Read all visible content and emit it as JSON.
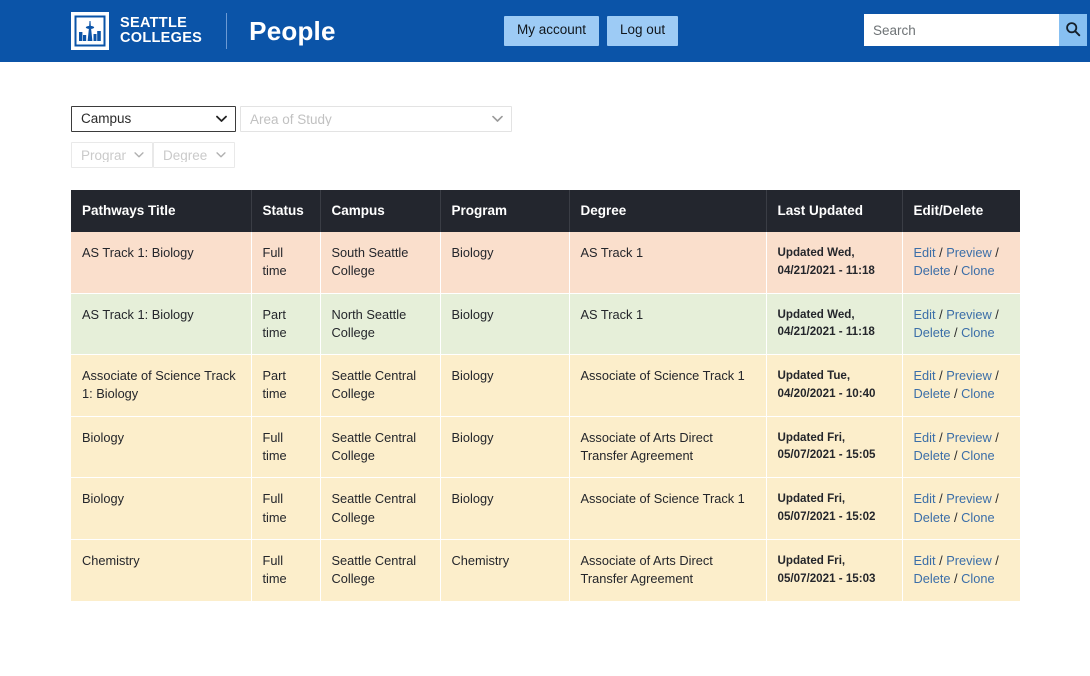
{
  "header": {
    "logo_icon": "seattle-colleges-skyline-logo",
    "logo_line1": "SEATTLE",
    "logo_line2": "COLLEGES",
    "app_title": "People",
    "my_account_label": "My account",
    "log_out_label": "Log out",
    "search_placeholder": "Search",
    "search_value": "",
    "search_icon": "search-icon",
    "brand_color": "#0b54a8",
    "button_color": "#9dcbf5"
  },
  "filters": [
    {
      "name": "campus",
      "value": "Campus",
      "disabled": false
    },
    {
      "name": "area-of-study",
      "value": "Area of Study",
      "disabled": true
    },
    {
      "name": "program",
      "value": "Program",
      "disabled": true
    },
    {
      "name": "degree",
      "value": "Degree",
      "disabled": true
    }
  ],
  "table": {
    "columns": [
      "Pathways Title",
      "Status",
      "Campus",
      "Program",
      "Degree",
      "Last Updated",
      "Edit/Delete"
    ],
    "action_links": [
      "Edit",
      "Preview",
      "Delete",
      "Clone"
    ],
    "action_separator": "/",
    "rows": [
      {
        "color": "peach",
        "title": "AS Track 1: Biology",
        "status": "Full time",
        "campus": "South Seattle College",
        "program": "Biology",
        "degree": "AS Track 1",
        "updated": "Updated Wed, 04/21/2021 - 11:18"
      },
      {
        "color": "green",
        "title": "AS Track 1: Biology",
        "status": "Part time",
        "campus": "North Seattle College",
        "program": "Biology",
        "degree": "AS Track 1",
        "updated": "Updated Wed, 04/21/2021 - 11:18"
      },
      {
        "color": "yellow",
        "title": "Associate of Science Track 1: Biology",
        "status": "Part time",
        "campus": "Seattle Central College",
        "program": "Biology",
        "degree": "Associate of Science Track 1",
        "updated": "Updated Tue, 04/20/2021 - 10:40"
      },
      {
        "color": "yellow",
        "title": "Biology",
        "status": "Full time",
        "campus": "Seattle Central College",
        "program": "Biology",
        "degree": "Associate of Arts Direct Transfer Agreement",
        "updated": "Updated Fri, 05/07/2021 - 15:05"
      },
      {
        "color": "yellow",
        "title": "Biology",
        "status": "Full time",
        "campus": "Seattle Central College",
        "program": "Biology",
        "degree": "Associate of Science Track 1",
        "updated": "Updated Fri, 05/07/2021 - 15:02"
      },
      {
        "color": "yellow",
        "title": "Chemistry",
        "status": "Full time",
        "campus": "Seattle Central College",
        "program": "Chemistry",
        "degree": "Associate of Arts Direct Transfer Agreement",
        "updated": "Updated Fri, 05/07/2021 - 15:03"
      }
    ]
  }
}
